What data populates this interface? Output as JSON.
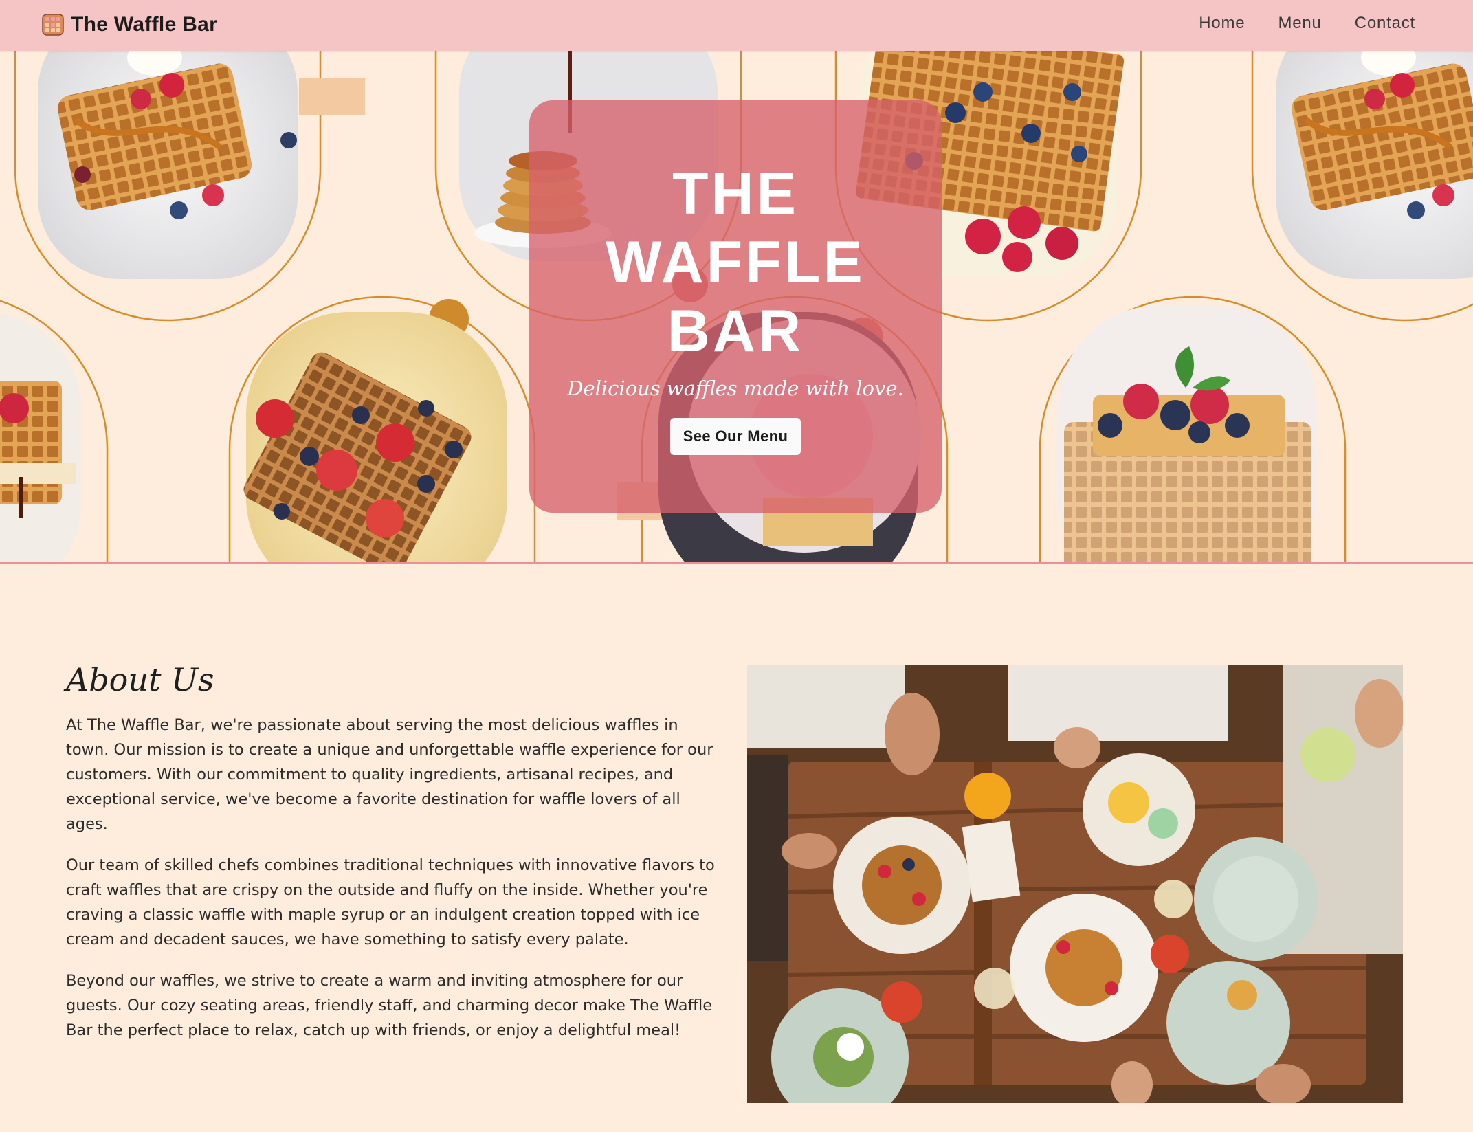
{
  "navbar": {
    "brand": "The Waffle Bar",
    "logo_icon": "waffle-logo-icon",
    "links": [
      {
        "label": "Home"
      },
      {
        "label": "Menu"
      },
      {
        "label": "Contact"
      }
    ]
  },
  "hero": {
    "title": "THE\nWAFFLE\nBAR",
    "tagline": "Delicious waffles made with love.",
    "cta_label": "See Our Menu"
  },
  "about": {
    "heading": "About Us",
    "paragraphs": [
      "At The Waffle Bar, we're passionate about serving the most delicious waffles in town. Our mission is to create a unique and unforgettable waffle experience for our customers. With our commitment to quality ingredients, artisanal recipes, and exceptional service, we've become a favorite destination for waffle lovers of all ages.",
      "Our team of skilled chefs combines traditional techniques with innovative flavors to craft waffles that are crispy on the outside and fluffy on the inside. Whether you're craving a classic waffle with maple syrup or an indulgent creation topped with ice cream and decadent sauces, we have something to satisfy every palate.",
      "Beyond our waffles, we strive to create a warm and inviting atmosphere for our guests. Our cozy seating areas, friendly staff, and charming decor make The Waffle Bar the perfect place to relax, catch up with friends, or enjoy a delightful meal!"
    ]
  },
  "colors": {
    "page_bg": "#feeddd",
    "navbar_bg": "#f5c5c6",
    "hero_card": "#d6626c",
    "arch_stroke": "#d98c2c",
    "accent_dot": "#d08a2e"
  }
}
